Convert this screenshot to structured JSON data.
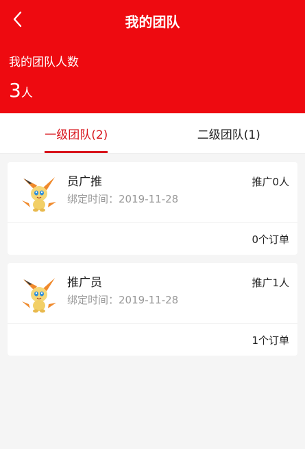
{
  "header": {
    "title": "我的团队",
    "count_label": "我的团队人数",
    "count_number": "3",
    "count_unit": "人"
  },
  "tabs": [
    {
      "label": "一级团队(2)",
      "active": true
    },
    {
      "label": "二级团队(1)",
      "active": false
    }
  ],
  "members": [
    {
      "name": "员广推",
      "bind_label": "绑定时间：",
      "bind_date": "2019-11-28",
      "promo": "推广0人",
      "orders": "0个订单"
    },
    {
      "name": "推广员",
      "bind_label": "绑定时间：",
      "bind_date": "2019-11-28",
      "promo": "推广1人",
      "orders": "1个订单"
    }
  ],
  "colors": {
    "header_bg": "#ee0a10",
    "accent": "#d8141b"
  }
}
